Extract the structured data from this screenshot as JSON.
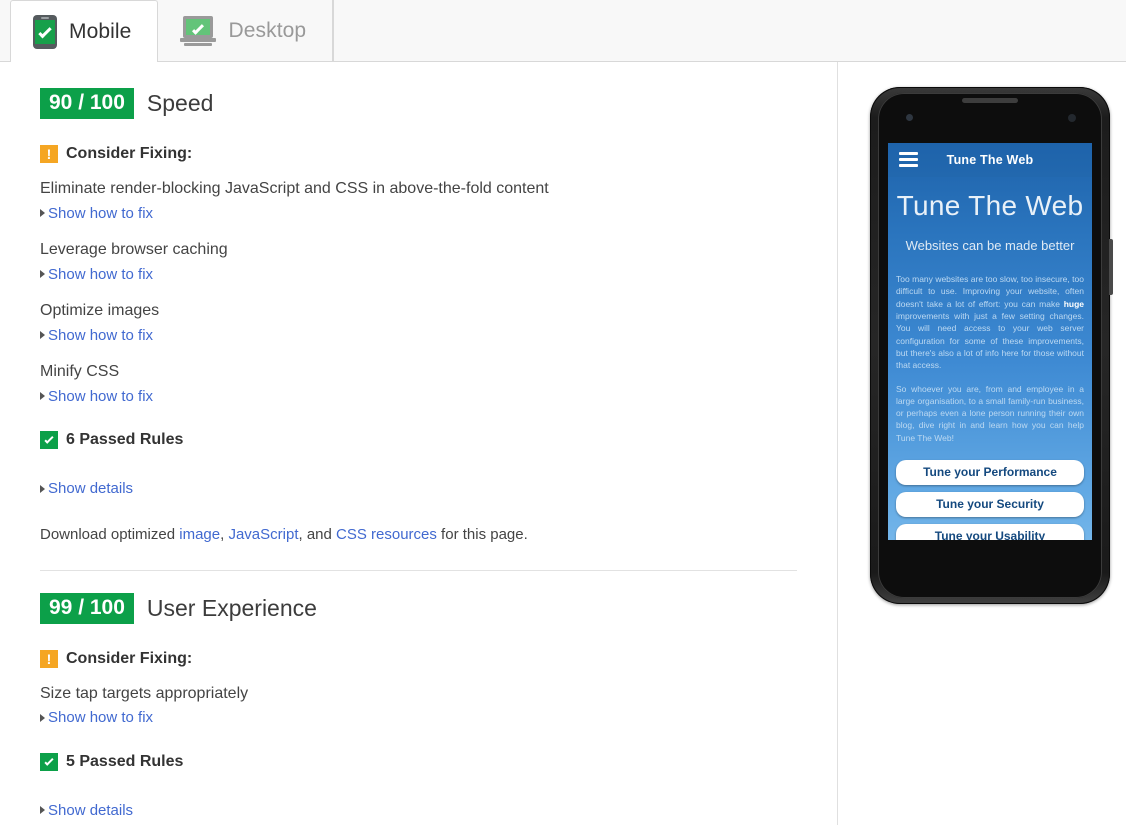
{
  "tabs": [
    {
      "label": "Mobile",
      "icon": "mobile-check-icon",
      "active": true
    },
    {
      "label": "Desktop",
      "icon": "desktop-check-icon",
      "active": false
    }
  ],
  "colors": {
    "pass_green": "#0ca049",
    "warn_orange": "#f5a623",
    "link_blue": "#4169d0",
    "phone_blue": "#2a74bd"
  },
  "sections": [
    {
      "score": "90 / 100",
      "title": "Speed",
      "consider_label": "Consider Fixing:",
      "rules": [
        {
          "name": "Eliminate render-blocking JavaScript and CSS in above-the-fold content",
          "link": "Show how to fix"
        },
        {
          "name": "Leverage browser caching",
          "link": "Show how to fix"
        },
        {
          "name": "Optimize images",
          "link": "Show how to fix"
        },
        {
          "name": "Minify CSS",
          "link": "Show how to fix"
        }
      ],
      "passed_label": "6 Passed Rules",
      "passed_link": "Show details",
      "download": {
        "prefix": "Download optimized ",
        "link1": "image",
        "sep1": ", ",
        "link2": "JavaScript",
        "sep2": ", and ",
        "link3": "CSS resources",
        "suffix": " for this page."
      }
    },
    {
      "score": "99 / 100",
      "title": "User Experience",
      "consider_label": "Consider Fixing:",
      "rules": [
        {
          "name": "Size tap targets appropriately",
          "link": "Show how to fix"
        }
      ],
      "passed_label": "5 Passed Rules",
      "passed_link": "Show details"
    }
  ],
  "phone_preview": {
    "header_title": "Tune The Web",
    "hero_title": "Tune The Web",
    "tagline": "Websites can be made better",
    "paragraph1_a": "Too many websites are too slow, too insecure, too difficult to use. Improving your website, often doesn't take a lot of effort: you can make ",
    "paragraph1_bold": "huge",
    "paragraph1_b": " improvements with just a few setting changes. You will need access to your web server configuration for some of these improvements, but there's also a lot of info here for those without that access.",
    "paragraph2": "So whoever you are, from and employee in a large organisation, to a small family-run business, or perhaps even a lone person running their own blog, dive right in and learn how you can help Tune The Web!",
    "buttons": [
      "Tune your Performance",
      "Tune your Security",
      "Tune your Usability"
    ]
  }
}
